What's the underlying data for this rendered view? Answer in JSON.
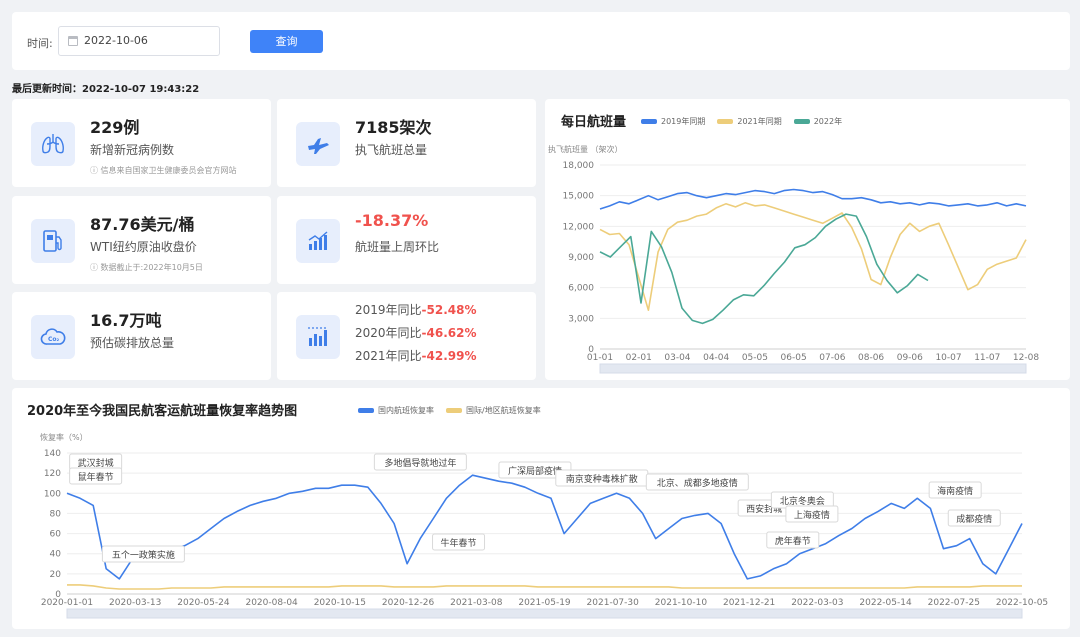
{
  "filter": {
    "time_label": "时间:",
    "date_value": "2022-10-06",
    "query_button": "查询"
  },
  "updated_text": "最后更新时间：2022-10-07 19:43:22",
  "stats": {
    "covid": {
      "value": "229例",
      "label": "新增新冠病例数",
      "note": "信息来自国家卫生健康委员会官方网站"
    },
    "flights": {
      "value": "7185架次",
      "label": "执飞航班总量"
    },
    "oil": {
      "value": "87.76美元/桶",
      "label": "WTI纽约原油收盘价",
      "note": "数据截止于:2022年10月5日"
    },
    "wow": {
      "value": "-18.37%",
      "label": "航班量上周环比"
    },
    "carbon": {
      "value": "16.7万吨",
      "label": "预估碳排放总量"
    },
    "yoy": [
      {
        "label": "2019年同比",
        "value": "-52.48%"
      },
      {
        "label": "2020年同比",
        "value": "-46.62%"
      },
      {
        "label": "2021年同比",
        "value": "-42.99%"
      }
    ]
  },
  "colors": {
    "blue": "#3f7ee8",
    "yellow": "#edcd7a",
    "green": "#4aa896",
    "red": "#f0524d"
  },
  "chart_data": [
    {
      "type": "line",
      "title": "每日航班量",
      "ylabel": "执飞航班量 （架次）",
      "ylim": [
        0,
        18000
      ],
      "yticks": [
        "0",
        "3,000",
        "6,000",
        "9,000",
        "12,000",
        "15,000",
        "18,000"
      ],
      "x_ticks": [
        "01-01",
        "02-01",
        "03-04",
        "04-04",
        "05-05",
        "06-05",
        "07-06",
        "08-06",
        "09-06",
        "10-07",
        "11-07",
        "12-08"
      ],
      "series": [
        {
          "name": "2019年同期",
          "color": "#3f7ee8",
          "values": [
            13700,
            14000,
            14400,
            14200,
            14600,
            15000,
            14600,
            14900,
            15200,
            15300,
            15000,
            14800,
            15000,
            15200,
            15100,
            15300,
            15500,
            15400,
            15200,
            15500,
            15600,
            15500,
            15300,
            15400,
            15100,
            14700,
            14700,
            14800,
            14600,
            14300,
            14400,
            14200,
            14300,
            14100,
            14300,
            14200,
            14000,
            14100,
            14200,
            14000,
            14100,
            14300,
            14000,
            14200,
            14000
          ]
        },
        {
          "name": "2021年同期",
          "color": "#edcd7a",
          "values": [
            11700,
            11200,
            11300,
            10200,
            7000,
            3800,
            9500,
            11700,
            12400,
            12600,
            13000,
            13200,
            13800,
            14200,
            13900,
            14300,
            14000,
            14100,
            13800,
            13500,
            13200,
            12900,
            12600,
            12300,
            12800,
            13300,
            11900,
            9800,
            6800,
            6300,
            9000,
            11200,
            12300,
            11500,
            12000,
            12300,
            10200,
            8000,
            5800,
            6300,
            7800,
            8300,
            8600,
            8900,
            10700
          ]
        },
        {
          "name": "2022年",
          "color": "#4aa896",
          "values": [
            9500,
            9000,
            10000,
            11000,
            4500,
            11500,
            10000,
            7500,
            4000,
            2800,
            2500,
            2900,
            3800,
            4800,
            5300,
            5200,
            6200,
            7400,
            8500,
            9900,
            10200,
            10900,
            12000,
            12700,
            13200,
            13000,
            11000,
            8300,
            6700,
            5500,
            6200,
            7300,
            6700
          ]
        }
      ]
    },
    {
      "type": "line",
      "title": "2020年至今我国民航客运航班量恢复率趋势图",
      "ylabel": "恢复率（%）",
      "ylim": [
        0,
        140
      ],
      "yticks": [
        "0",
        "20",
        "40",
        "60",
        "80",
        "100",
        "120",
        "140"
      ],
      "x_ticks": [
        "2020-01-01",
        "2020-03-13",
        "2020-05-24",
        "2020-08-04",
        "2020-10-15",
        "2020-12-26",
        "2021-03-08",
        "2021-05-19",
        "2021-07-30",
        "2021-10-10",
        "2021-12-21",
        "2022-03-03",
        "2022-05-14",
        "2022-07-25",
        "2022-10-05"
      ],
      "series": [
        {
          "name": "国内航班恢复率",
          "color": "#3f7ee8",
          "values": [
            100,
            95,
            88,
            25,
            15,
            35,
            40,
            42,
            45,
            48,
            55,
            65,
            75,
            82,
            88,
            92,
            95,
            100,
            102,
            105,
            105,
            108,
            108,
            106,
            90,
            70,
            30,
            55,
            75,
            95,
            108,
            118,
            115,
            112,
            110,
            106,
            100,
            95,
            60,
            75,
            90,
            95,
            100,
            95,
            80,
            55,
            65,
            75,
            78,
            80,
            70,
            40,
            15,
            18,
            25,
            30,
            40,
            45,
            50,
            58,
            65,
            75,
            82,
            90,
            85,
            95,
            85,
            45,
            48,
            55,
            30,
            20,
            45,
            70
          ]
        },
        {
          "name": "国际/地区航班恢复率",
          "color": "#edcd7a",
          "values": [
            9,
            9,
            8,
            6,
            5,
            5,
            5,
            5,
            6,
            6,
            6,
            6,
            7,
            7,
            7,
            7,
            7,
            7,
            7,
            7,
            7,
            8,
            8,
            8,
            8,
            7,
            7,
            7,
            7,
            8,
            8,
            8,
            8,
            8,
            8,
            8,
            7,
            7,
            7,
            7,
            7,
            7,
            7,
            7,
            7,
            7,
            7,
            6,
            6,
            6,
            6,
            6,
            6,
            6,
            6,
            6,
            6,
            6,
            6,
            6,
            6,
            6,
            6,
            6,
            6,
            7,
            7,
            7,
            7,
            7,
            8,
            8,
            8,
            8
          ]
        }
      ],
      "annotations": [
        {
          "text": "武汉封城",
          "t": 0.03
        },
        {
          "text": "鼠年春节",
          "t": 0.03
        },
        {
          "text": "五个一政策实施",
          "t": 0.08
        },
        {
          "text": "多地倡导就地过年",
          "t": 0.37
        },
        {
          "text": "牛年春节",
          "t": 0.41
        },
        {
          "text": "广深局部疫情",
          "t": 0.49
        },
        {
          "text": "南京变种毒株扩散",
          "t": 0.56
        },
        {
          "text": "北京、成都多地疫情",
          "t": 0.66
        },
        {
          "text": "西安封城",
          "t": 0.73
        },
        {
          "text": "北京冬奥会",
          "t": 0.77
        },
        {
          "text": "上海疫情",
          "t": 0.78
        },
        {
          "text": "虎年春节",
          "t": 0.76
        },
        {
          "text": "海南疫情",
          "t": 0.93
        },
        {
          "text": "成都疫情",
          "t": 0.95
        }
      ]
    }
  ]
}
